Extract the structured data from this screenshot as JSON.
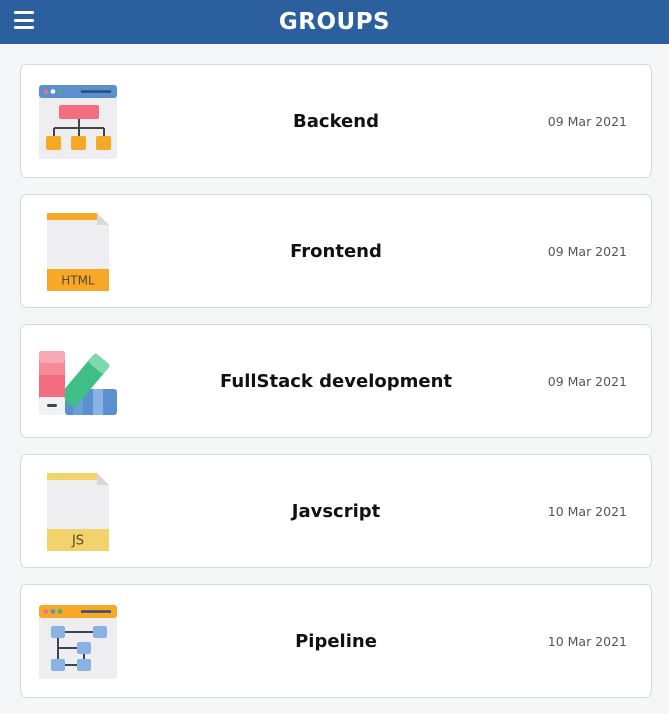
{
  "header": {
    "title": "GROUPS",
    "menu_icon": "hamburger-menu-icon"
  },
  "groups": [
    {
      "name": "Backend",
      "date": "09 Mar 2021",
      "icon": "backend-hierarchy-icon"
    },
    {
      "name": "Frontend",
      "date": "09 Mar 2021",
      "icon": "html-file-icon"
    },
    {
      "name": "FullStack development",
      "date": "09 Mar 2021",
      "icon": "color-palette-icon"
    },
    {
      "name": "Javscript",
      "date": "10 Mar 2021",
      "icon": "js-file-icon"
    },
    {
      "name": "Pipeline",
      "date": "10 Mar 2021",
      "icon": "pipeline-flow-icon"
    }
  ],
  "icon_labels": {
    "html": "HTML",
    "js": "JS"
  },
  "colors": {
    "header": "#2c5f9e",
    "card_border": "#d6d8db",
    "background": "#f5f6f8"
  }
}
